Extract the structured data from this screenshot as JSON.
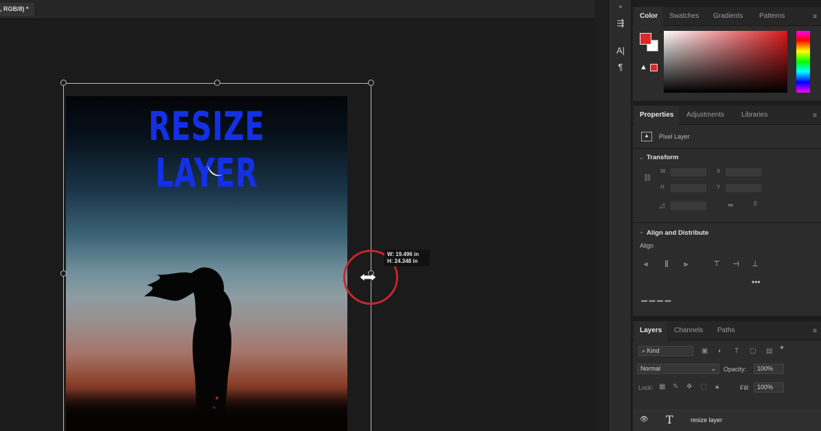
{
  "document": {
    "tab_label": ", RGB/8) *"
  },
  "artwork": {
    "title": "RESIZE LAYER"
  },
  "transform_hud": {
    "width": "W: 19.496 in",
    "height": "H: 24.348 in"
  },
  "toolstrip": {
    "icons": [
      "properties-icon",
      "character-icon",
      "paragraph-icon"
    ]
  },
  "color_panel": {
    "tabs": [
      "Color",
      "Swatches",
      "Gradients",
      "Patterns"
    ],
    "foreground": "#e3262b",
    "background": "#ffffff"
  },
  "properties_panel": {
    "tabs": [
      "Properties",
      "Adjustments",
      "Libraries"
    ],
    "layer_kind": "Pixel Layer",
    "transform_label": "Transform",
    "align_distribute_label": "Align and Distribute",
    "align_label": "Align"
  },
  "layers_panel": {
    "tabs": [
      "Layers",
      "Channels",
      "Paths"
    ],
    "filter_placeholder": "Kind",
    "blend_mode": "Normal",
    "opacity_label": "Opacity:",
    "opacity_value": "100%",
    "lock_label": "Lock:",
    "fill_label": "Fill:",
    "fill_value": "100%",
    "layers": [
      {
        "name": "resize layer",
        "type": "text"
      }
    ]
  }
}
